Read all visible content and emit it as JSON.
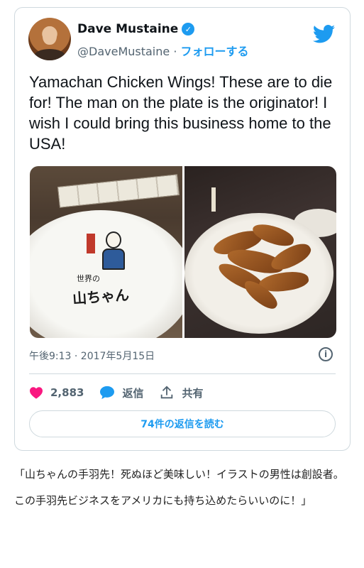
{
  "author": {
    "name": "Dave Mustaine",
    "verified_mark": "✓",
    "handle": "@DaveMustaine",
    "separator": "·",
    "follow_label": "フォローする"
  },
  "tweet": {
    "text": "Yamachan Chicken Wings! These are to die for! The man on the plate is the originator! I wish I could bring this business home to the USA!",
    "plate_logo": "山ちゃん",
    "plate_logo_small": "世界の",
    "timestamp": "午後9:13 · 2017年5月15日",
    "info_icon": "i"
  },
  "actions": {
    "likes": "2,883",
    "reply_label": "返信",
    "share_label": "共有",
    "read_replies_label": "74件の返信を読む"
  },
  "caption": "「山ちゃんの手羽先！死ぬほど美味しい！イラストの男性は創設者。この手羽先ビジネスをアメリカにも持ち込めたらいいのに！」",
  "colors": {
    "accent": "#1d9bf0",
    "like": "#f91880",
    "muted": "#536471",
    "border": "#cfd9de"
  },
  "icons": [
    "verified-badge-icon",
    "twitter-bird-icon",
    "info-icon",
    "heart-icon",
    "reply-bubble-icon",
    "share-icon"
  ]
}
